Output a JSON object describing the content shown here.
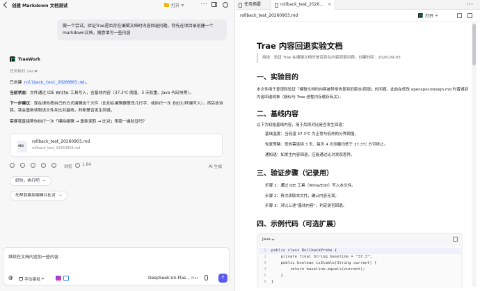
{
  "left": {
    "window_title": "创建 Markdown 文档测试",
    "open_label": "打开",
    "user_message": "做一个尝试。验证Trae是否存在编辑文档时内容回退问题。你先在项目录创建一个markdown文档，随意填写一些内容",
    "assistant_name": "TraeWork",
    "task_done": "任务耗时 24s",
    "p1_prefix": "已创建",
    "p1_code": "rollback_test_20260903.md",
    "p1_suffix": "。",
    "p2_label": "当前状态",
    "p2_pre": "：文件通过 IDE ",
    "p2_kbd": "Write",
    "p2_post": " 工具写入，含基线内容（37.3℃ 阈值、3 天权重、Java 代码块等）。",
    "p3_label": "下一步建议",
    "p3_pre": "：现在请你按自己的方式编辑这个文件（比如在编辑器里改几行字、或执行一次 ",
    "p3_kbd": "Edit",
    "p3_post": "/终端写入），然后告诉我，我会重新读取该文件并比对基线，判断是否发生回退。",
    "p4": "需要我直接帮你执行一次「模拟编辑 → 重新读取 → 比对」来跑一遍验证吗？",
    "file_name": "rollback_test_20260903.md",
    "file_sub": "rollback_test_20260903.md",
    "file_badge": "MD",
    "action_view": "浏览",
    "action_count": "1.64",
    "action_ai": "AI 生成",
    "chip1": "好的，执行吧",
    "chip2": "先帮我模拟编辑并比对",
    "input_text": "继续在文档内追加一些内容",
    "mode_label": "手动审批",
    "model_name": "DeepSeek-V4-Flas...",
    "max_label": "Max",
    "send": "↑"
  },
  "right": {
    "tab1": "任务摘要",
    "tab2": "rollback_test_2026...",
    "path": "rollback_test_20260903.md",
    "open_label": "打开",
    "h1": "Trae 内容回退实验文档",
    "quote": "用途：验证 Trae 在编辑文档时是否存在内容回退问题。创建时间：2026-09-03",
    "h2_1": "一、实验目的",
    "p1": "本文件用于复现和验证「编辑文档时内容被异常恢复到旧版本/回退」的问题。此前在修改 openspec/design.md 时曾遇到内容回退现象（疑似与 Trae 进程内存缓存有关）。",
    "h2_2": "二、基线内容",
    "p2": "以下为初始基线内容，用于后续对比是否发生回退：",
    "li1": "基线温度：当低温 37.3℃ 为正常与低热的分界阈值。",
    "li2": "恢复策略：低热需连续 3 天、每天 4 次测量均低于 37.3℃ 方可终止。",
    "li3": "通知语：如发生内容回退，应能通过比对发现差异。",
    "h2_3": "三、验证步骤（记录用）",
    "s1": "步骤 1：通过 IDE 工具（Write/Edit）写入本文件。",
    "s2": "步骤 2：再次读取本文件，确认内容无误。",
    "s3": "步骤 3：对比上述“基线内容”，判定是否回退。",
    "h2_4": "四、示例代码（可选扩展）",
    "code_lang": "Java",
    "code_lines": [
      "public class RollbackProbe {",
      "    private final String baseline = \"37.3\";",
      "    public boolean isStable(String current) {",
      "        return baseline.equals(current);",
      "    }",
      "}"
    ],
    "line_numbers": [
      "1",
      "2",
      "3",
      "4",
      "5",
      "6"
    ]
  }
}
